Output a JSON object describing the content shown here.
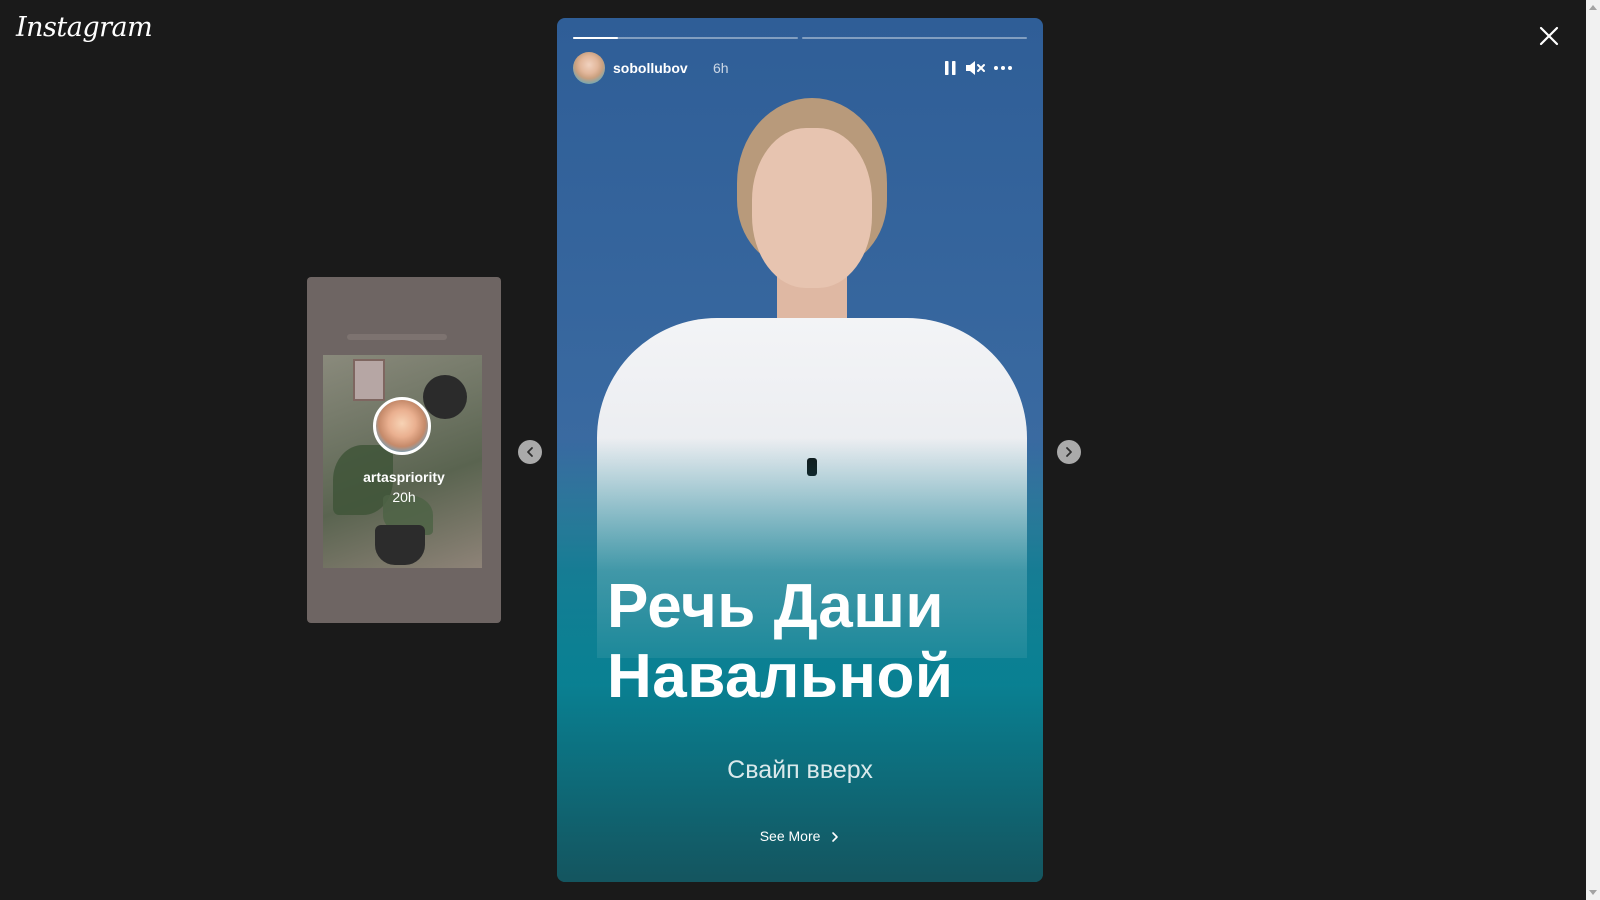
{
  "app": {
    "logo": "Instagram"
  },
  "preview_story": {
    "username": "artaspriority",
    "time": "20h"
  },
  "story": {
    "username": "sobollubov",
    "time": "6h",
    "progress": [
      0.2,
      0.0
    ],
    "headline_line1": "Речь Даши",
    "headline_line2": "Навальной",
    "swipe_text": "Свайп вверх",
    "see_more_label": "See More"
  },
  "icons": {
    "close": "close-icon",
    "prev": "chevron-left-icon",
    "next": "chevron-right-icon",
    "pause": "pause-icon",
    "mute": "muted-speaker-icon",
    "more": "more-horizontal-icon"
  }
}
